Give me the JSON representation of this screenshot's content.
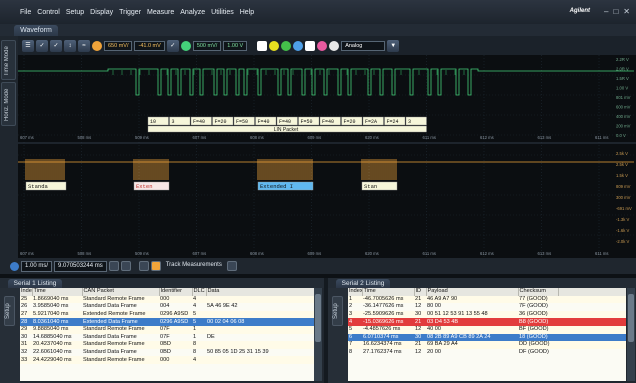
{
  "menu": [
    "File",
    "Control",
    "Setup",
    "Display",
    "Trigger",
    "Measure",
    "Analyze",
    "Utilities",
    "Help"
  ],
  "brand": "Agilent",
  "window_tab": "Waveform",
  "side_tabs": [
    "Time Mode",
    "Horiz. Mode"
  ],
  "toolbar": {
    "ch1_scale": "650 mV/",
    "ch1_offset": "-41.0 mV",
    "ch2_scale": "500 mV/",
    "ch2_offset": "1.00 V",
    "mode": "Analog"
  },
  "colors": {
    "ch1": "#44d07a",
    "ch2": "#f0a43a",
    "lin_box": "#f6f6da",
    "can_error": "#e23c3c",
    "can_ext": "#60b8f0"
  },
  "waveform": {
    "time_labels": [
      "607 ms",
      "508 ms",
      "509 ms",
      "607 ms",
      "608 ms",
      "609 ms",
      "620 ms",
      "611 ms",
      "612 ms",
      "613 ms",
      "611 ms"
    ],
    "lin_fields": [
      "10",
      "3",
      "F=40",
      "F=20",
      "F=50",
      "F=40",
      "F=40",
      "F=50",
      "F=40",
      "F=20",
      "F=2A",
      "F=24",
      "3"
    ],
    "lin_label": "LIN Packet",
    "can_labels": [
      "Standa",
      "Exten",
      "Extended I",
      "Stan"
    ],
    "right_scale_top": [
      "2.2R V",
      "2.0R V",
      "1.5R V",
      "1.00 V",
      "801 mV",
      "600 mV",
      "400 mV",
      "200 mV",
      "0.0 V"
    ],
    "right_scale_bottom": [
      "2.5k V",
      "2.5k V",
      "1.5k V",
      "809 mV",
      "300 mV",
      "-691 mV",
      "-1.3k V",
      "-1.6k V",
      "-2.0k V"
    ]
  },
  "statusbar": {
    "scale": "1.00 ms/",
    "position": "9.070503244 ms",
    "track": "Track Measurements"
  },
  "serial1": {
    "tab": "Serial 1 Listing",
    "side": "Setup",
    "columns": [
      "Index",
      "Time",
      "CAN Packet",
      "Identifier",
      "DLC",
      "Data"
    ],
    "rows": [
      [
        "25",
        "1.8669040 ms",
        "Standard Remote Frame",
        "000",
        "4",
        ""
      ],
      [
        "26",
        "3.9585040 ms",
        "Standard Data Frame",
        "004",
        "4",
        "5A 46 9E 42"
      ],
      [
        "27",
        "5.9217040 ms",
        "Extended Remote Frame",
        "0296 A9SD",
        "5",
        ""
      ],
      [
        "28",
        "8.0361040 ms",
        "Extended Data Frame",
        "0296 A9SD",
        "5",
        "00 02 04 06 08"
      ],
      [
        "29",
        "9.8885040 ms",
        "Standard Remote Frame",
        "07F",
        "1",
        ""
      ],
      [
        "30",
        "14.6885040 ms",
        "Standard Data Frame",
        "07F",
        "1",
        "DE"
      ],
      [
        "31",
        "20.4237040 ms",
        "Standard Remote Frame",
        "0BD",
        "8",
        ""
      ],
      [
        "32",
        "22.6061040 ms",
        "Standard Data Frame",
        "0BD",
        "8",
        "50 85 05 1D 25 31 15 39"
      ],
      [
        "33",
        "24.4229040 ms",
        "Standard Remote Frame",
        "000",
        "4",
        ""
      ]
    ],
    "selected": 3
  },
  "serial2": {
    "tab": "Serial 2 Listing",
    "side": "Setup",
    "columns": [
      "Index",
      "Time",
      "ID",
      "Payload",
      "Checksum"
    ],
    "rows": [
      [
        "1",
        "-46.7005626 ms",
        "21",
        "46 A9 A7 90",
        "77 (GOOD)"
      ],
      [
        "2",
        "-36.1477626 ms",
        "12",
        "80 00",
        "7F (GOOD)"
      ],
      [
        "3",
        "-25.5909626 ms",
        "30",
        "00 51 12 53 91 13 55 48",
        "36 (GOOD)"
      ],
      [
        "4",
        "-15.0369626 ms",
        "21",
        "03 D4 53 4B",
        "B8 (GOOD)"
      ],
      [
        "5",
        "-4.4857626 ms",
        "12",
        "40 00",
        "BF (GOOD)"
      ],
      [
        "6",
        "6.0710374 ms",
        "30",
        "08 2B 89 A9 CB 89 2A 24",
        "18 (GOOD)"
      ],
      [
        "7",
        "16.6234374 ms",
        "21",
        "69 BA 29 A4",
        "DD (GOOD)"
      ],
      [
        "8",
        "27.1762374 ms",
        "12",
        "20 00",
        "DF (GOOD)"
      ]
    ],
    "error_row": 3,
    "selected": 5
  }
}
